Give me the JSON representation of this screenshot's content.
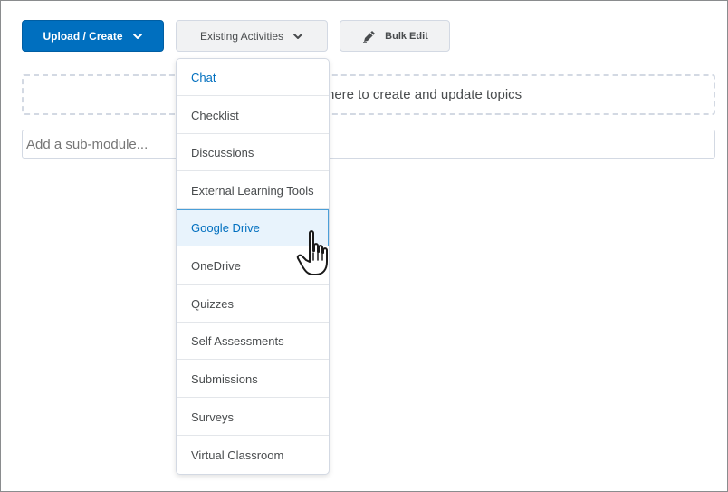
{
  "toolbar": {
    "upload_create_label": "Upload / Create",
    "existing_activities_label": "Existing Activities",
    "bulk_edit_label": "Bulk Edit"
  },
  "dropzone": {
    "text": "here to create and update topics"
  },
  "submodule": {
    "placeholder": "Add a sub-module..."
  },
  "menu": {
    "items": [
      {
        "label": "Chat"
      },
      {
        "label": "Checklist"
      },
      {
        "label": "Discussions"
      },
      {
        "label": "External Learning Tools"
      },
      {
        "label": "Google Drive"
      },
      {
        "label": "OneDrive"
      },
      {
        "label": "Quizzes"
      },
      {
        "label": "Self Assessments"
      },
      {
        "label": "Submissions"
      },
      {
        "label": "Surveys"
      },
      {
        "label": "Virtual Classroom"
      }
    ],
    "hovered_item": "Google Drive"
  },
  "colors": {
    "primary": "#006fbf",
    "hover_bg": "#e8f3fc",
    "border": "#d3d9e3"
  },
  "icons": {
    "upload_chevron": "chevron-down-icon",
    "existing_chevron": "chevron-down-icon",
    "bulk_edit": "pencil-icon",
    "cursor": "hand-pointer-icon"
  }
}
